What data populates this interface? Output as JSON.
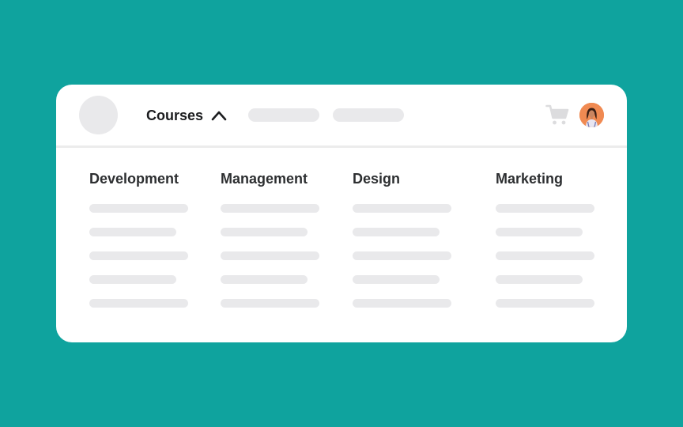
{
  "nav": {
    "courses_label": "Courses",
    "courses_icon": "chevron-up-icon",
    "cart_icon": "shopping-cart-icon",
    "avatar_icon": "user-avatar"
  },
  "categories": [
    {
      "label": "Development"
    },
    {
      "label": "Management"
    },
    {
      "label": "Design"
    },
    {
      "label": "Marketing"
    }
  ],
  "colors": {
    "background": "#0fa39e",
    "card": "#ffffff",
    "placeholder": "#e9e9eb",
    "avatar_bg": "#f08a52",
    "heading": "#2d2f31"
  }
}
